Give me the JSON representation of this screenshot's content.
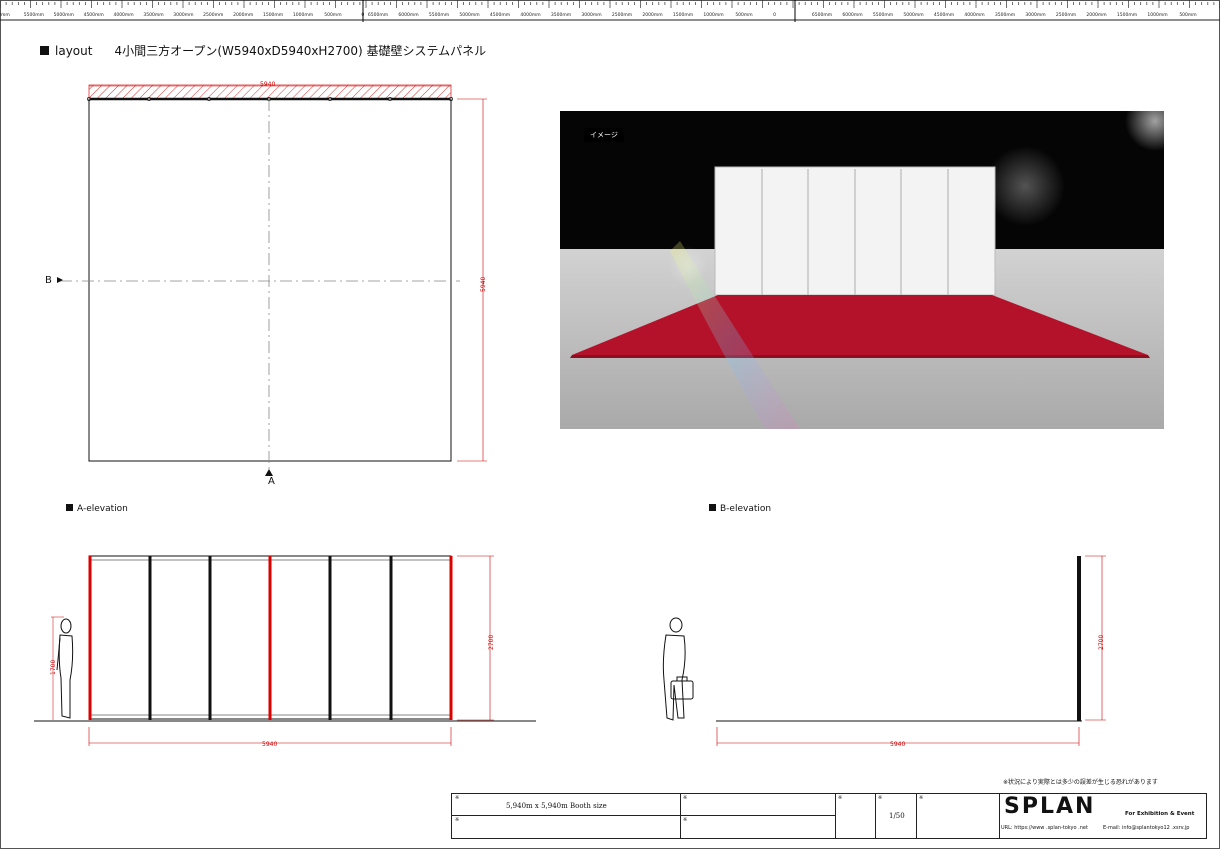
{
  "title": {
    "label": "layout",
    "description": "4小間三方オープン(W5940xD5940xH2700) 基礎壁システムパネル"
  },
  "ruler": {
    "left": [
      "0mm",
      "5500mm",
      "5000mm",
      "4500mm",
      "4000mm",
      "3500mm",
      "3000mm",
      "2500mm",
      "2000mm",
      "1500mm",
      "1000mm",
      "500mm",
      "0"
    ],
    "mid": [
      "6500mm",
      "6000mm",
      "5500mm",
      "5000mm",
      "4500mm",
      "4000mm",
      "3500mm",
      "3000mm",
      "2500mm",
      "2000mm",
      "1500mm",
      "1000mm",
      "500mm",
      "0"
    ],
    "right": [
      "6500mm",
      "6000mm",
      "5500mm",
      "5000mm",
      "4500mm",
      "4000mm",
      "3500mm",
      "3000mm",
      "2500mm",
      "2000mm",
      "1500mm",
      "1000mm",
      "500mm"
    ]
  },
  "plan": {
    "width_dim": "5940",
    "depth_dim": "5940",
    "marker_a": "A",
    "marker_b": "B"
  },
  "render": {
    "label": "イメージ",
    "colors": {
      "carpet": "#b3122a",
      "wall": "#f2f2f2",
      "sky": "#050505",
      "floor": "#bdbdbd"
    }
  },
  "elevation_a": {
    "heading": "A-elevation",
    "height_dim": "2700",
    "width_dim": "5940",
    "person_dim": "1700"
  },
  "elevation_b": {
    "heading": "B-elevation",
    "height_dim": "2700",
    "width_dim": "5940"
  },
  "note": "※状況により実際とは多少の誤差が生じる恐れがあります",
  "title_block": {
    "booth_size": "5,940m  x 5,940m  Booth  size",
    "scale": "1/50",
    "logo": "SPLAN",
    "tagline": "For Exhibition & Event",
    "url": "URL: https://www .splan-tokyo .net",
    "email": "E-mail: info@splantokyo12 .xsrv.jp",
    "mark": "※"
  },
  "colors": {
    "dimension": "#cc0000",
    "line": "#111111"
  }
}
